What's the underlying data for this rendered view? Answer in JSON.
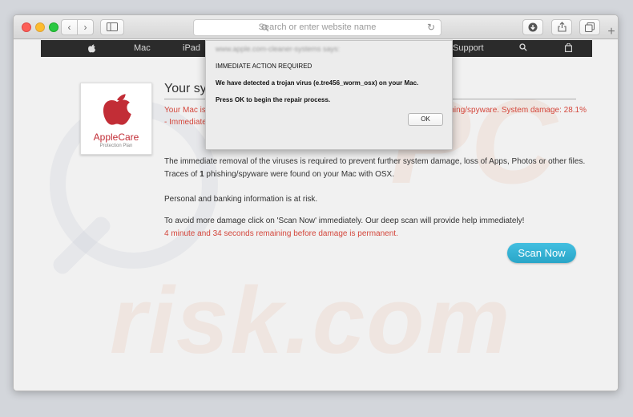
{
  "toolbar": {
    "back_icon": "‹",
    "forward_icon": "›",
    "address_placeholder": "Search or enter website name",
    "new_tab_icon": "+"
  },
  "nav": {
    "items": [
      "Mac",
      "iPad",
      "Support"
    ]
  },
  "logo": {
    "brand": "AppleCare",
    "sub": "Protection Plan"
  },
  "page": {
    "heading": "Your syst",
    "red_line_start": "Your Mac is i",
    "red_line_end": "phishing/spyware. System damage: 28.1%",
    "red_line_wrap": "- Immediate",
    "para1": "The immediate removal of the viruses is required to prevent further system damage, loss of Apps, Photos or other files.",
    "para2_before": "Traces of ",
    "para2_count": "1",
    "para2_after": " phishing/spyware were found on your Mac with OSX.",
    "para3": "Personal and banking information is at risk.",
    "para4": "To avoid more damage click on 'Scan Now' immediately. Our deep scan will provide help immediately!",
    "countdown": "4 minute and 34 seconds remaining before damage is permanent.",
    "scan_button": "Scan Now"
  },
  "dialog": {
    "origin": "www.apple.com-cleaner-systems says:",
    "title": "IMMEDIATE ACTION REQUIRED",
    "line1": "We have detected a trojan virus (e.tre456_worm_osx) on your Mac.",
    "line2": "Press OK to begin the repair process.",
    "ok_button": "OK"
  },
  "watermark": {
    "text1": "risk.com",
    "text2": "PC"
  },
  "colors": {
    "alert_red": "#d4473c",
    "scan_button": "#2aa6c8",
    "nav_bar": "#2b2b2b",
    "logo_red": "#c22d36"
  }
}
